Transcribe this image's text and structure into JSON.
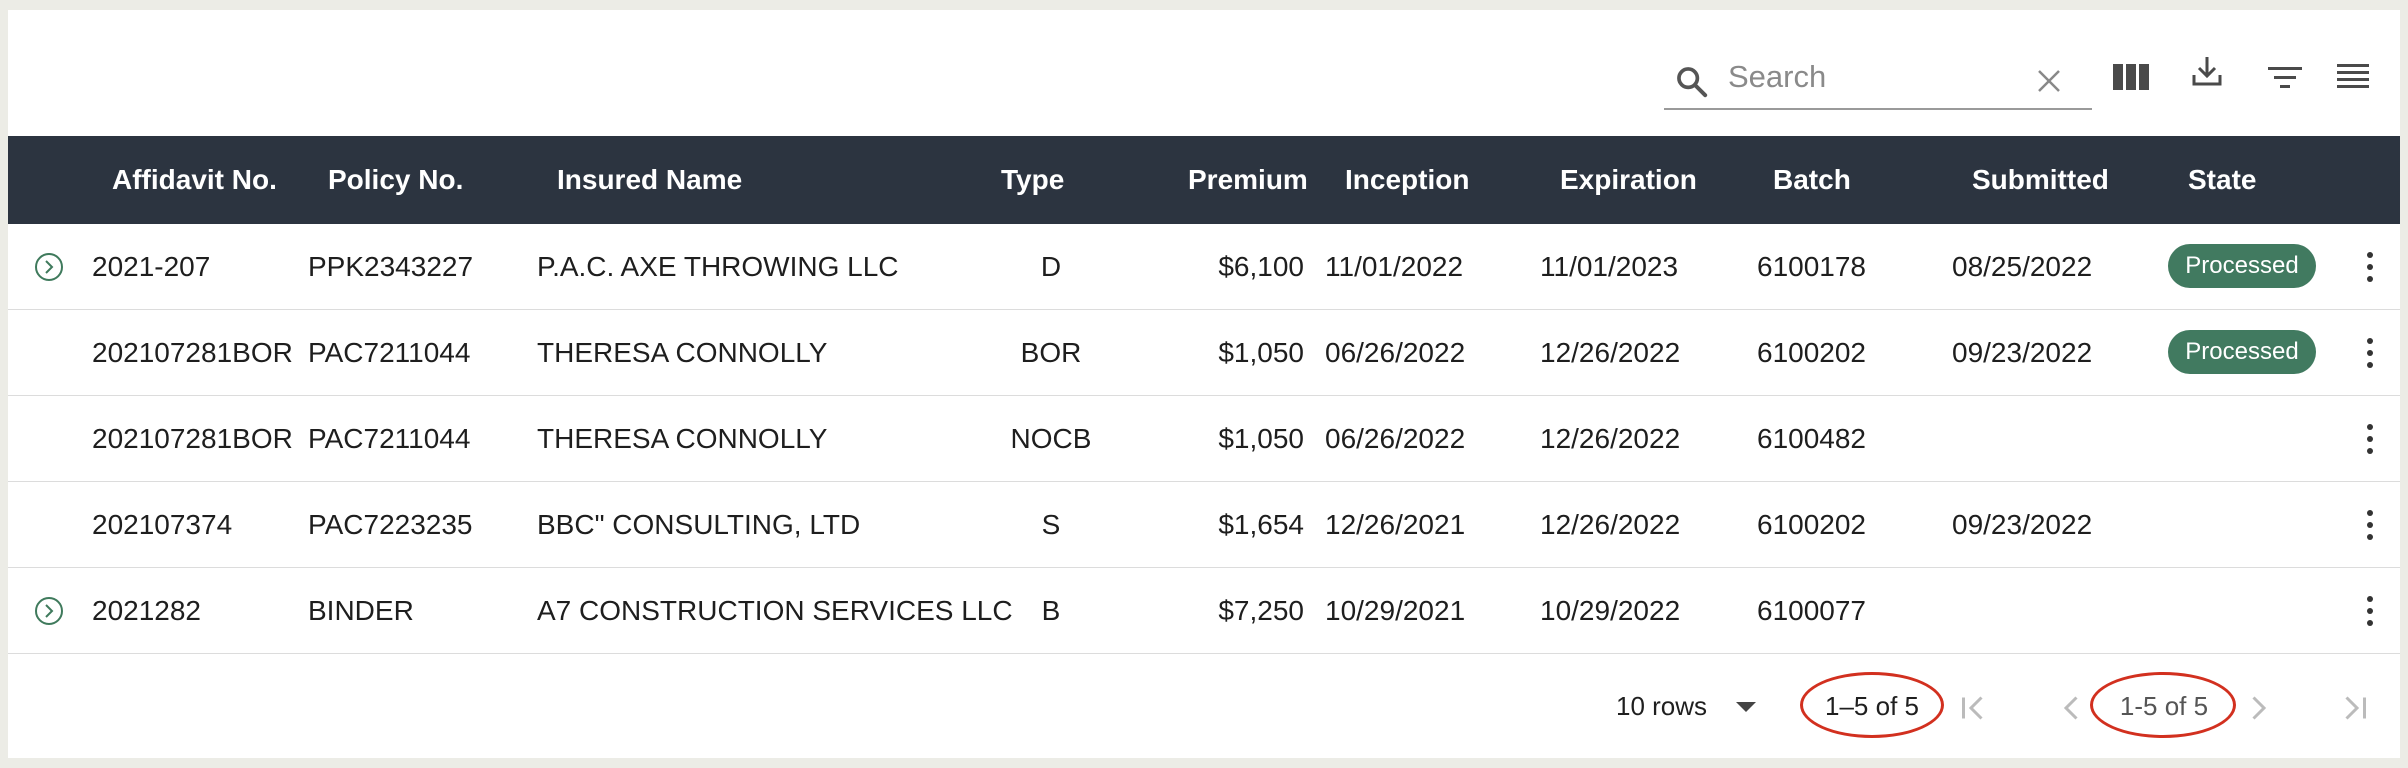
{
  "toolbar": {
    "search_placeholder": "Search",
    "icons": [
      "search-icon",
      "clear-icon",
      "columns-icon",
      "download-icon",
      "filter-icon",
      "density-icon"
    ]
  },
  "columns": [
    "Affidavit No.",
    "Policy No.",
    "Insured Name",
    "Type",
    "Premium",
    "Inception",
    "Expiration",
    "Batch",
    "Submitted",
    "State"
  ],
  "rows": [
    {
      "expandable": true,
      "affidavit": "2021-207",
      "policy": "PPK2343227",
      "insured": "P.A.C. AXE THROWING LLC",
      "type": "D",
      "premium": "$6,100",
      "inception": "11/01/2022",
      "expiration": "11/01/2023",
      "batch": "6100178",
      "submitted": "08/25/2022",
      "state": "Processed"
    },
    {
      "expandable": false,
      "affidavit": "202107281BOR",
      "policy": "PAC7211044",
      "insured": "THERESA CONNOLLY",
      "type": "BOR",
      "premium": "$1,050",
      "inception": "06/26/2022",
      "expiration": "12/26/2022",
      "batch": "6100202",
      "submitted": "09/23/2022",
      "state": "Processed"
    },
    {
      "expandable": false,
      "affidavit": "202107281BOR",
      "policy": "PAC7211044",
      "insured": "THERESA CONNOLLY",
      "type": "NOCB",
      "premium": "$1,050",
      "inception": "06/26/2022",
      "expiration": "12/26/2022",
      "batch": "6100482",
      "submitted": "",
      "state": ""
    },
    {
      "expandable": false,
      "affidavit": "202107374",
      "policy": "PAC7223235",
      "insured": "BBC\" CONSULTING, LTD",
      "type": "S",
      "premium": "$1,654",
      "inception": "12/26/2021",
      "expiration": "12/26/2022",
      "batch": "6100202",
      "submitted": "09/23/2022",
      "state": ""
    },
    {
      "expandable": true,
      "affidavit": "2021282",
      "policy": "BINDER",
      "insured": "A7 CONSTRUCTION SERVICES LLC",
      "type": "B",
      "premium": "$7,250",
      "inception": "10/29/2021",
      "expiration": "10/29/2022",
      "batch": "6100077",
      "submitted": "",
      "state": ""
    }
  ],
  "footer": {
    "rows_per_page": "10 rows",
    "range_primary": "1–5 of 5",
    "range_secondary": "1-5 of 5"
  },
  "colors": {
    "header_bg": "#2c3440",
    "badge_bg": "#417a60",
    "expand_icon": "#3f7a5c",
    "annotation_circle": "#d2301f"
  }
}
